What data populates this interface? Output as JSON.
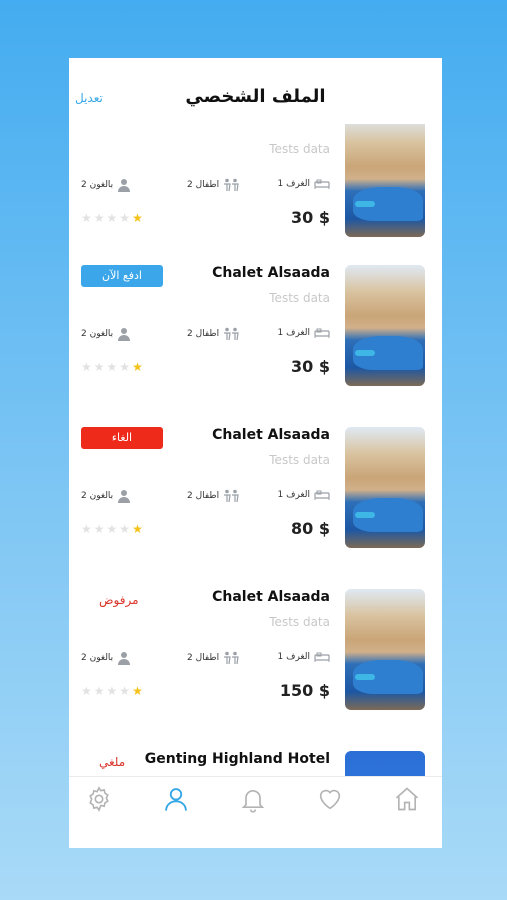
{
  "header": {
    "title": "الملف الشخصي",
    "edit_label": "تعديل"
  },
  "bookings": [
    {
      "title": "",
      "subtitle": "Tests data",
      "rooms": "1 الغرف",
      "kids": "2 اطفال",
      "adults": "2 بالغون",
      "price": "30 $",
      "rating": 1,
      "status": ""
    },
    {
      "title": "Chalet Alsaada",
      "subtitle": "Tests data",
      "rooms": "1 الغرف",
      "kids": "2 اطفال",
      "adults": "2 بالغون",
      "price": "30 $",
      "rating": 1,
      "status": "ادفع الآن"
    },
    {
      "title": "Chalet Alsaada",
      "subtitle": "Tests data",
      "rooms": "1 الغرف",
      "kids": "2 اطفال",
      "adults": "2 بالغون",
      "price": "80 $",
      "rating": 1,
      "status": "الغاء"
    },
    {
      "title": "Chalet Alsaada",
      "subtitle": "Tests data",
      "rooms": "1 الغرف",
      "kids": "2 اطفال",
      "adults": "2 بالغون",
      "price": "150 $",
      "rating": 1,
      "status": "مرفوض"
    },
    {
      "title": "Genting Highland Hotel",
      "status": "ملغي"
    }
  ],
  "colors": {
    "accent": "#35a7e6",
    "cancel": "#ee2a1b",
    "rejected": "#d9342b",
    "star": "#f4c21a"
  },
  "tabbar": {
    "items": [
      {
        "icon": "gear-icon",
        "active": false
      },
      {
        "icon": "user-icon",
        "active": true
      },
      {
        "icon": "bell-icon",
        "active": false
      },
      {
        "icon": "heart-icon",
        "active": false
      },
      {
        "icon": "home-icon",
        "active": false
      }
    ]
  }
}
